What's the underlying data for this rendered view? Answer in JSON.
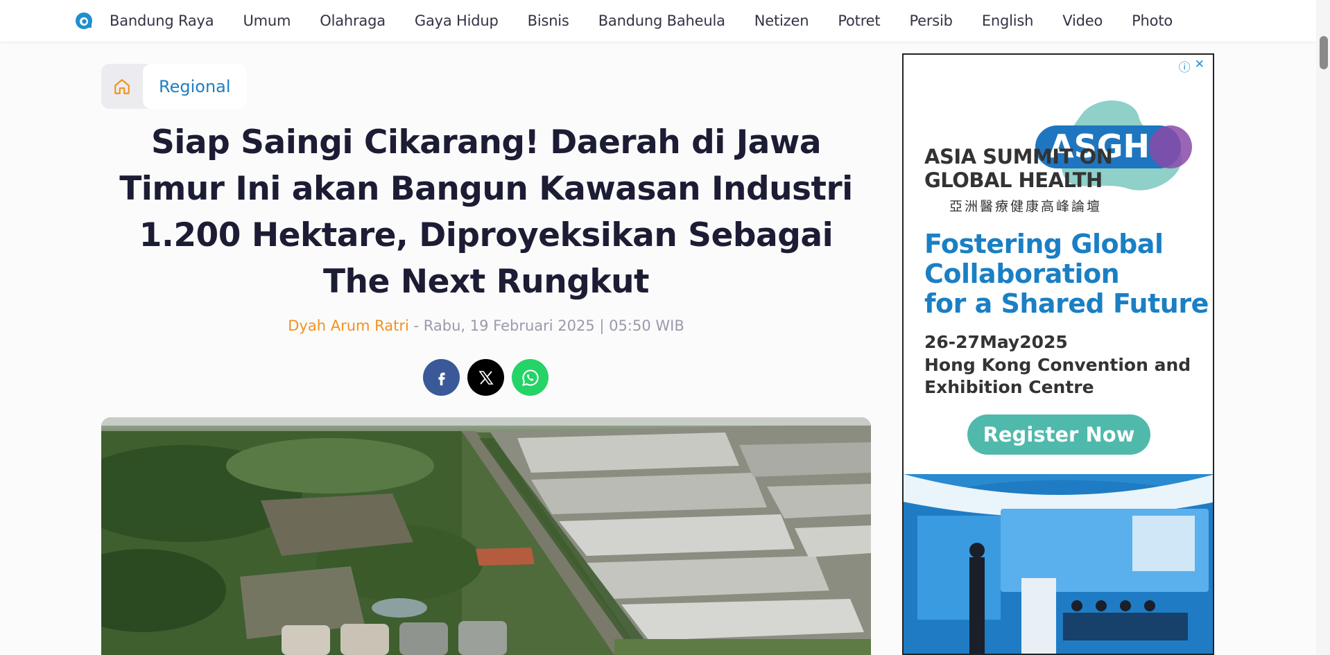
{
  "nav": {
    "items": [
      "Bandung Raya",
      "Umum",
      "Olahraga",
      "Gaya Hidup",
      "Bisnis",
      "Bandung Baheula",
      "Netizen",
      "Potret",
      "Persib",
      "English",
      "Video",
      "Photo"
    ]
  },
  "breadcrumb": {
    "category": "Regional"
  },
  "article": {
    "title": "Siap Saingi Cikarang! Daerah di Jawa Timur Ini akan Bangun Kawasan Industri 1.200 Hektare, Diproyeksikan Sebagai The Next Rungkut",
    "author": "Dyah Arum Ratri",
    "separator": " - ",
    "date": "Rabu, 19 Februari 2025 | 05:50 WIB"
  },
  "share": {
    "facebook": "facebook-icon",
    "x": "x-icon",
    "whatsapp": "whatsapp-icon"
  },
  "ad": {
    "logo_text": "ASGH",
    "title_line1": "ASIA SUMMIT ON",
    "title_line2": "GLOBAL HEALTH",
    "title_cn": "亞洲醫療健康高峰論壇",
    "headline_line1": "Fostering Global",
    "headline_line2": "Collaboration",
    "headline_line3": "for a Shared Future",
    "dates": "26-27May2025",
    "venue_line1": "Hong Kong Convention and",
    "venue_line2": "Exhibition Centre",
    "cta": "Register Now"
  },
  "colors": {
    "accent_blue": "#1f7fc0",
    "author_orange": "#f0921e",
    "facebook": "#3b5998",
    "whatsapp": "#25d366",
    "ad_teal": "#4fb9ac"
  }
}
